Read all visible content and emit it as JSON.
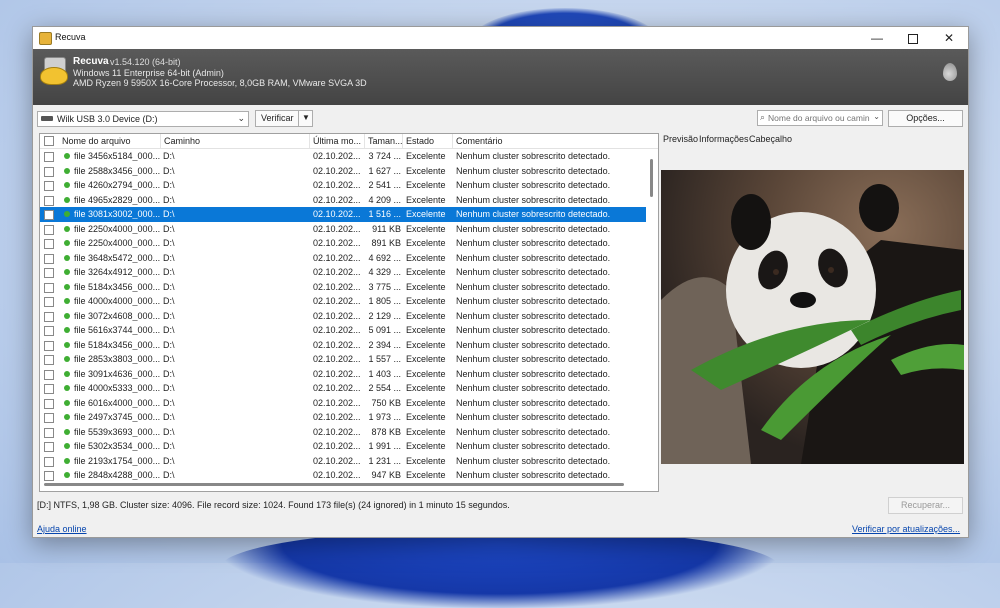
{
  "window": {
    "title": "Recuva"
  },
  "header": {
    "app_name": "Recuva",
    "version": "v1.54.120 (64-bit)",
    "os": "Windows 11 Enterprise 64-bit (Admin)",
    "hardware": "AMD Ryzen 9 5950X 16-Core Processor, 8,0GB RAM, VMware SVGA 3D"
  },
  "toolbar": {
    "drive": "Wilk USB 3.0 Device (D:)",
    "verify_label": "Verificar",
    "search_placeholder": "Nome do arquivo ou caminho",
    "options_label": "Opções..."
  },
  "columns": [
    "Nome do arquivo",
    "Caminho",
    "Última mo...",
    "Taman...",
    "Estado",
    "Comentário"
  ],
  "files": [
    {
      "name": "file 3456x5184_000...",
      "path": "D:\\",
      "date": "02.10.202...",
      "size": "3 724 ...",
      "state": "Excelente",
      "comment": "Nenhum cluster sobrescrito detectado."
    },
    {
      "name": "file 2588x3456_000...",
      "path": "D:\\",
      "date": "02.10.202...",
      "size": "1 627 ...",
      "state": "Excelente",
      "comment": "Nenhum cluster sobrescrito detectado."
    },
    {
      "name": "file 4260x2794_000...",
      "path": "D:\\",
      "date": "02.10.202...",
      "size": "2 541 ...",
      "state": "Excelente",
      "comment": "Nenhum cluster sobrescrito detectado."
    },
    {
      "name": "file 4965x2829_000...",
      "path": "D:\\",
      "date": "02.10.202...",
      "size": "4 209 ...",
      "state": "Excelente",
      "comment": "Nenhum cluster sobrescrito detectado."
    },
    {
      "name": "file 3081x3002_000...",
      "path": "D:\\",
      "date": "02.10.202...",
      "size": "1 516 ...",
      "state": "Excelente",
      "comment": "Nenhum cluster sobrescrito detectado.",
      "selected": true
    },
    {
      "name": "file 2250x4000_000...",
      "path": "D:\\",
      "date": "02.10.202...",
      "size": "911 KB",
      "state": "Excelente",
      "comment": "Nenhum cluster sobrescrito detectado."
    },
    {
      "name": "file 2250x4000_000...",
      "path": "D:\\",
      "date": "02.10.202...",
      "size": "891 KB",
      "state": "Excelente",
      "comment": "Nenhum cluster sobrescrito detectado."
    },
    {
      "name": "file 3648x5472_000...",
      "path": "D:\\",
      "date": "02.10.202...",
      "size": "4 692 ...",
      "state": "Excelente",
      "comment": "Nenhum cluster sobrescrito detectado."
    },
    {
      "name": "file 3264x4912_000...",
      "path": "D:\\",
      "date": "02.10.202...",
      "size": "4 329 ...",
      "state": "Excelente",
      "comment": "Nenhum cluster sobrescrito detectado."
    },
    {
      "name": "file 5184x3456_000...",
      "path": "D:\\",
      "date": "02.10.202...",
      "size": "3 775 ...",
      "state": "Excelente",
      "comment": "Nenhum cluster sobrescrito detectado."
    },
    {
      "name": "file 4000x4000_000...",
      "path": "D:\\",
      "date": "02.10.202...",
      "size": "1 805 ...",
      "state": "Excelente",
      "comment": "Nenhum cluster sobrescrito detectado."
    },
    {
      "name": "file 3072x4608_000...",
      "path": "D:\\",
      "date": "02.10.202...",
      "size": "2 129 ...",
      "state": "Excelente",
      "comment": "Nenhum cluster sobrescrito detectado."
    },
    {
      "name": "file 5616x3744_000...",
      "path": "D:\\",
      "date": "02.10.202...",
      "size": "5 091 ...",
      "state": "Excelente",
      "comment": "Nenhum cluster sobrescrito detectado."
    },
    {
      "name": "file 5184x3456_000...",
      "path": "D:\\",
      "date": "02.10.202...",
      "size": "2 394 ...",
      "state": "Excelente",
      "comment": "Nenhum cluster sobrescrito detectado."
    },
    {
      "name": "file 2853x3803_000...",
      "path": "D:\\",
      "date": "02.10.202...",
      "size": "1 557 ...",
      "state": "Excelente",
      "comment": "Nenhum cluster sobrescrito detectado."
    },
    {
      "name": "file 3091x4636_000...",
      "path": "D:\\",
      "date": "02.10.202...",
      "size": "1 403 ...",
      "state": "Excelente",
      "comment": "Nenhum cluster sobrescrito detectado."
    },
    {
      "name": "file 4000x5333_000...",
      "path": "D:\\",
      "date": "02.10.202...",
      "size": "2 554 ...",
      "state": "Excelente",
      "comment": "Nenhum cluster sobrescrito detectado."
    },
    {
      "name": "file 6016x4000_000...",
      "path": "D:\\",
      "date": "02.10.202...",
      "size": "750 KB",
      "state": "Excelente",
      "comment": "Nenhum cluster sobrescrito detectado."
    },
    {
      "name": "file 2497x3745_000...",
      "path": "D:\\",
      "date": "02.10.202...",
      "size": "1 973 ...",
      "state": "Excelente",
      "comment": "Nenhum cluster sobrescrito detectado."
    },
    {
      "name": "file 5539x3693_000...",
      "path": "D:\\",
      "date": "02.10.202...",
      "size": "878 KB",
      "state": "Excelente",
      "comment": "Nenhum cluster sobrescrito detectado."
    },
    {
      "name": "file 5302x3534_000...",
      "path": "D:\\",
      "date": "02.10.202...",
      "size": "1 991 ...",
      "state": "Excelente",
      "comment": "Nenhum cluster sobrescrito detectado."
    },
    {
      "name": "file 2193x1754_000...",
      "path": "D:\\",
      "date": "02.10.202...",
      "size": "1 231 ...",
      "state": "Excelente",
      "comment": "Nenhum cluster sobrescrito detectado."
    },
    {
      "name": "file 2848x4288_000...",
      "path": "D:\\",
      "date": "02.10.202...",
      "size": "947 KB",
      "state": "Excelente",
      "comment": "Nenhum cluster sobrescrito detectado."
    }
  ],
  "tabs": [
    "Previsão",
    "Informações",
    "Cabeçalho"
  ],
  "status": "[D:] NTFS, 1,98 GB. Cluster size: 4096. File record size: 1024. Found 173 file(s) (24 ignored) in 1 minuto 15 segundos.",
  "recover_label": "Recuperar...",
  "links": {
    "help": "Ajuda online",
    "updates": "Verificar por atualizações..."
  },
  "colors": {
    "selection": "#0a78d7",
    "status_ok": "#3fae33",
    "header_bg": "#4f4f4f",
    "link": "#0645ad"
  }
}
